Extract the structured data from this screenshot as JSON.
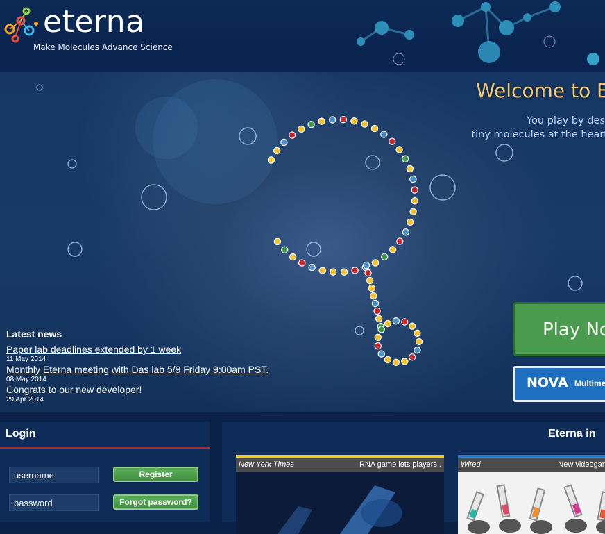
{
  "header": {
    "logo_text": "eterna",
    "tagline": "Make Molecules  Advance Science"
  },
  "hero": {
    "welcome_title": "Welcome to E",
    "description_line1": "You play by des",
    "description_line2": "tiny molecules at the heart",
    "play_button": "Play No",
    "nova_label": "NOVA",
    "nova_sub": "Multime",
    "icons": [
      "rna-loop-icon",
      "bubble-icon",
      "molecule-icon"
    ]
  },
  "news": {
    "heading": "Latest news",
    "items": [
      {
        "title": "Paper lab deadlines extended by 1 week",
        "date": "11 May 2014"
      },
      {
        "title": "Monthly Eterna meeting with Das lab 5/9 Friday 9:00am PST.",
        "date": "08 May 2014"
      },
      {
        "title": "Congrats to our new developer!",
        "date": "29 Apr 2014"
      }
    ]
  },
  "login": {
    "title": "Login",
    "username_placeholder": "username",
    "password_placeholder": "password",
    "register_label": "Register",
    "forgot_label": "Forgot password?"
  },
  "in_the_news": {
    "title": "Eterna in",
    "cards": [
      {
        "source": "New York Times",
        "headline": "RNA game lets players.."
      },
      {
        "source": "Wired",
        "headline": "New videogan"
      }
    ]
  },
  "colors": {
    "background": "#0b2146",
    "accent_red": "#b8242b",
    "play_green": "#4b9b4e",
    "welcome_gold": "#f3c97a",
    "nova_blue": "#1f6fbf"
  }
}
